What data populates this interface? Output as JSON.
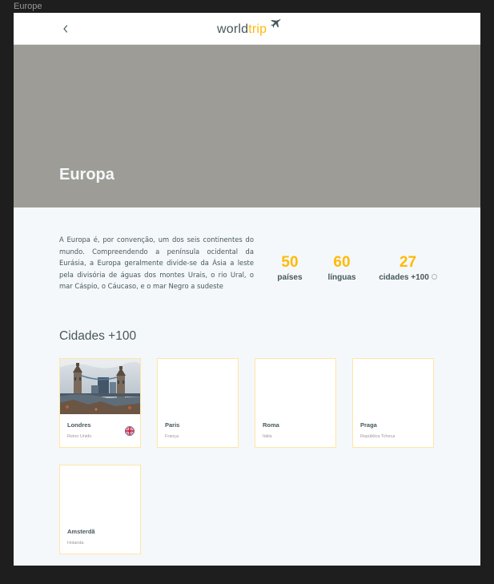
{
  "frame": {
    "label": "Europe"
  },
  "header": {
    "back_icon": "chevron-left-icon",
    "logo": {
      "primary": "world",
      "accent": "trip",
      "icon": "airplane-icon"
    }
  },
  "colors": {
    "accent": "#ffba08",
    "dark_text": "#47585b",
    "banner": "#9e9c96",
    "background": "#f5f8fa",
    "card_border": "#ffe5a5"
  },
  "banner": {
    "title": "Europa"
  },
  "description": "A Europa é, por convenção, um dos seis continentes do mundo. Compreendendo a península ocidental da Eurásia, a Europa geralmente divide-se da Ásia a leste pela divisória de águas dos montes Urais, o rio Ural, o mar Cáspio, o Cáucaso, e o mar Negro a sudeste",
  "stats": [
    {
      "value": "50",
      "label": "países"
    },
    {
      "value": "60",
      "label": "línguas"
    },
    {
      "value": "27",
      "label": "cidades +100",
      "icon": "info-icon"
    }
  ],
  "cities_section": {
    "title": "Cidades +100",
    "cards": [
      {
        "name": "Londres",
        "country": "Reino Unido",
        "has_photo": true,
        "flag": "uk-flag-icon"
      },
      {
        "name": "Paris",
        "country": "França"
      },
      {
        "name": "Roma",
        "country": "Itália"
      },
      {
        "name": "Praga",
        "country": "República Tcheca"
      },
      {
        "name": "Amsterdã",
        "country": "Holanda"
      }
    ]
  }
}
